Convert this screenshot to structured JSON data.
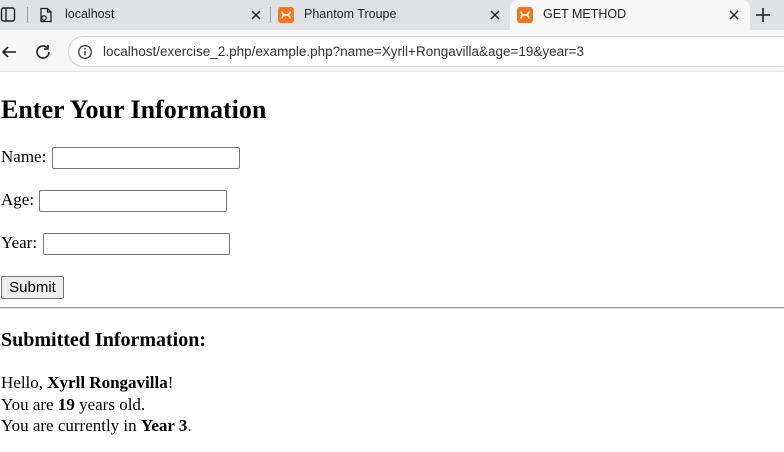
{
  "browser": {
    "tabs": [
      {
        "label": "localhost",
        "icon": "file-icon",
        "active": false
      },
      {
        "label": "Phantom Troupe",
        "icon": "xampp-icon",
        "active": false
      },
      {
        "label": "GET METHOD",
        "icon": "xampp-icon",
        "active": true
      }
    ],
    "url": "localhost/exercise_2.php/example.php?name=Xyrll+Rongavilla&age=19&year=3",
    "accent_color": "#f5761a"
  },
  "page": {
    "heading": "Enter Your Information",
    "form": {
      "name_label": "Name:",
      "name_value": "",
      "age_label": "Age:",
      "age_value": "",
      "year_label": "Year:",
      "year_value": "",
      "submit_label": "Submit"
    },
    "result": {
      "heading": "Submitted Information:",
      "hello_prefix": "Hello, ",
      "name": "Xyrll Rongavilla",
      "hello_suffix": "!",
      "age_prefix": "You are ",
      "age": "19",
      "age_suffix": " years old.",
      "year_prefix": "You are currently in ",
      "year": "Year 3",
      "year_suffix": "."
    }
  }
}
